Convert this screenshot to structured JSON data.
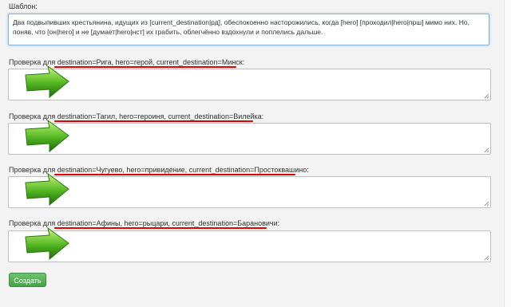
{
  "template": {
    "label": "Шаблон:",
    "text": "Два подвыпивших крестьянина, идущих из [current_destination|рд], обеспокоенно насторожились, когда [hero] [проходил|hero|прш] мимо них. Но, поняв, что [он|hero] и не [думает|hero|нст] их грабить, облегчённо вздохнули и поплелись дальше."
  },
  "checks": [
    {
      "prefix": "Проверка для ",
      "params": "destination=Рига, hero=герой, current_destination=Минск:"
    },
    {
      "prefix": "Проверка для ",
      "params": "destination=Тагил, hero=героиня, current_destination=Вилейка:"
    },
    {
      "prefix": "Проверка для ",
      "params": "destination=Чугуево, hero=привидение, current_destination=Простоквашино:"
    },
    {
      "prefix": "Проверка для ",
      "params": "destination=Афины, hero=рыцари, current_destination=Барановичи:"
    }
  ],
  "submit_label": "Создать",
  "colors": {
    "accent_green": "#45a445",
    "underline_red": "#e00000",
    "focus_blue": "#7fb6e6"
  }
}
